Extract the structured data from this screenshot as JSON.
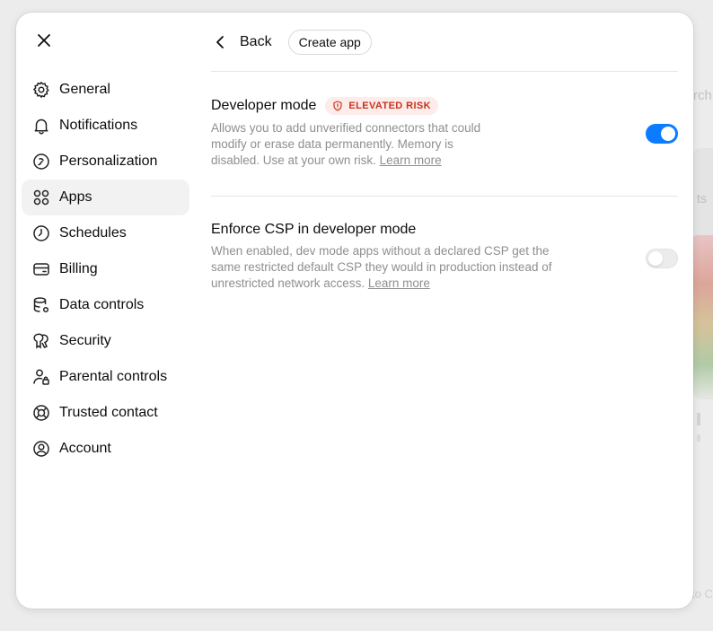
{
  "background": {
    "search_fragment": "rch",
    "card_fragment": "ts",
    "footer_fragment": "to C"
  },
  "close_icon": "close-icon",
  "nav": {
    "items": [
      {
        "label": "General",
        "icon": "gear-icon"
      },
      {
        "label": "Notifications",
        "icon": "bell-icon"
      },
      {
        "label": "Personalization",
        "icon": "personalization-icon"
      },
      {
        "label": "Apps",
        "icon": "apps-grid-icon",
        "active": true
      },
      {
        "label": "Schedules",
        "icon": "clock-icon"
      },
      {
        "label": "Billing",
        "icon": "credit-card-icon"
      },
      {
        "label": "Data controls",
        "icon": "database-gear-icon"
      },
      {
        "label": "Security",
        "icon": "security-key-icon"
      },
      {
        "label": "Parental controls",
        "icon": "person-lock-icon"
      },
      {
        "label": "Trusted contact",
        "icon": "lifebuoy-icon"
      },
      {
        "label": "Account",
        "icon": "user-circle-icon"
      }
    ]
  },
  "header": {
    "back_label": "Back",
    "create_app_label": "Create app"
  },
  "settings": {
    "developer_mode": {
      "title": "Developer mode",
      "badge": "ELEVATED RISK",
      "description": "Allows you to add unverified connectors that could modify or erase data permanently. Memory is disabled. Use at your own risk.",
      "learn_more": "Learn more",
      "enabled": true
    },
    "enforce_csp": {
      "title": "Enforce CSP in developer mode",
      "description": "When enabled, dev mode apps without a declared CSP get the same restricted default CSP they would in production instead of unrestricted network access.",
      "learn_more": "Learn more",
      "enabled": false
    }
  },
  "colors": {
    "toggle_on": "#0a7cff",
    "risk_text": "#c7341f",
    "risk_bg": "#fdecea",
    "active_nav_bg": "#f2f2f2"
  }
}
